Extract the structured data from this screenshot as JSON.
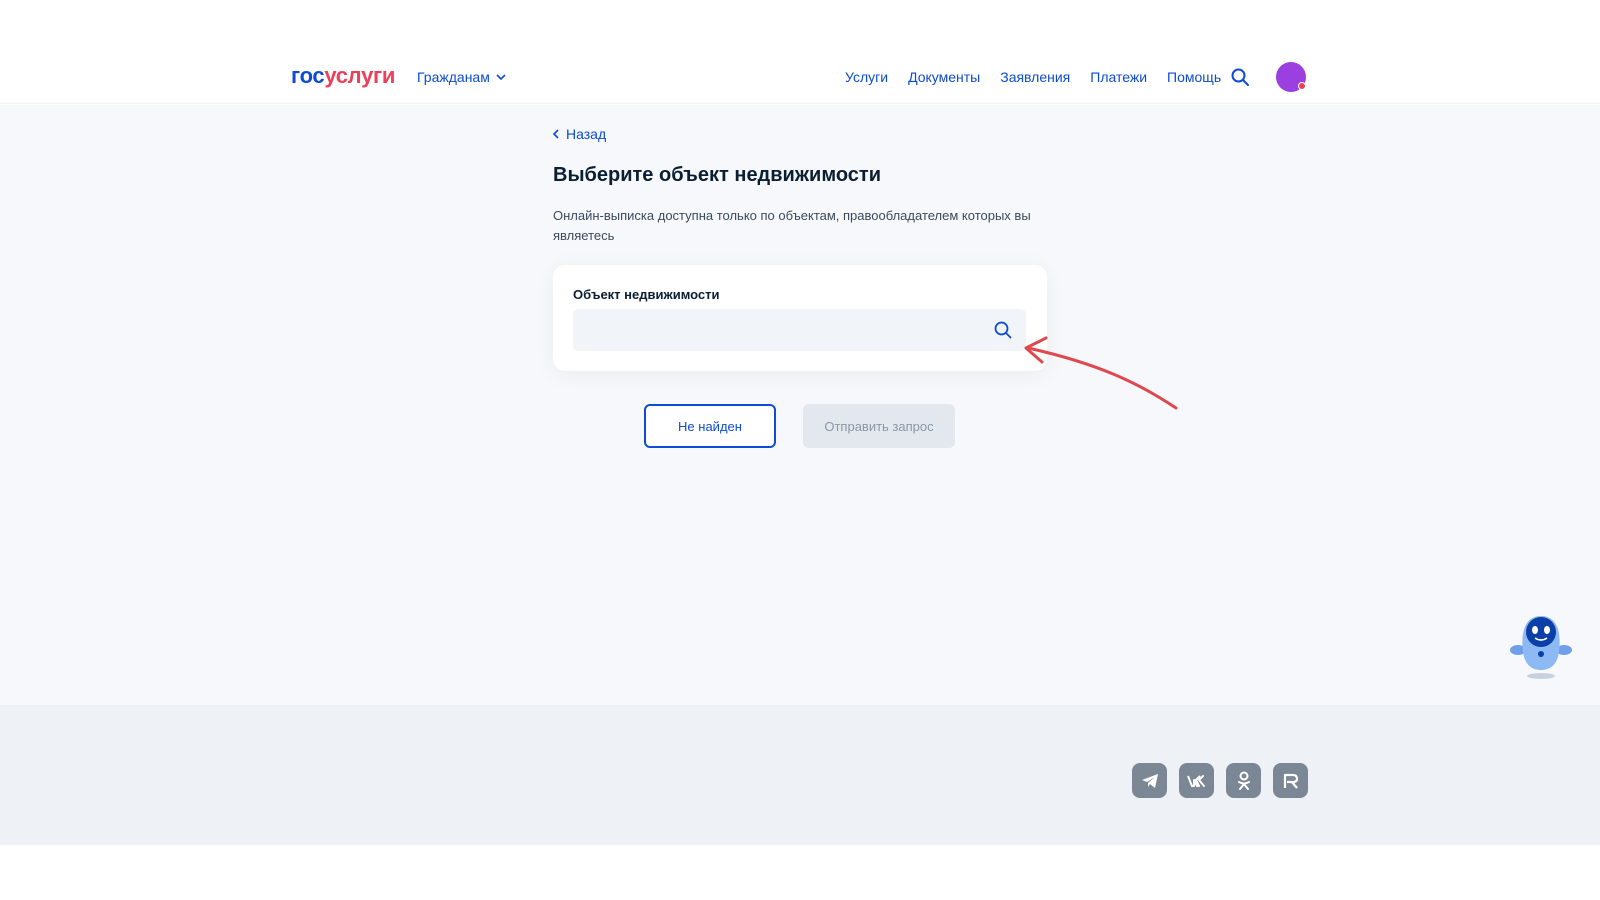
{
  "header": {
    "logo": {
      "part1": "гос",
      "part2": "услуги"
    },
    "audience_label": "Гражданам",
    "nav": [
      "Услуги",
      "Документы",
      "Заявления",
      "Платежи",
      "Помощь"
    ],
    "search_icon": "search-icon",
    "avatar_color": "#9b3fe0",
    "notification_color": "#ee3f58"
  },
  "main": {
    "back_label": "Назад",
    "title": "Выберите объект недвижимости",
    "subtitle": "Онлайн-выписка доступна только по объектам, правообладателем которых вы являетесь",
    "field": {
      "label": "Объект недвижимости",
      "value": "",
      "placeholder": ""
    },
    "buttons": {
      "not_found": "Не найден",
      "send": "Отправить запрос"
    }
  },
  "annotation": {
    "type": "arrow",
    "color": "#e0484f"
  },
  "assistant": {
    "icon": "robot-assistant-icon"
  },
  "footer": {
    "socials": [
      "telegram-icon",
      "vk-icon",
      "odnoklassniki-icon",
      "rutube-icon"
    ]
  },
  "colors": {
    "accent": "#0d4cd3",
    "brand_red": "#ee3f58",
    "background": "#f6f8fb",
    "text": "#0b1f33"
  }
}
